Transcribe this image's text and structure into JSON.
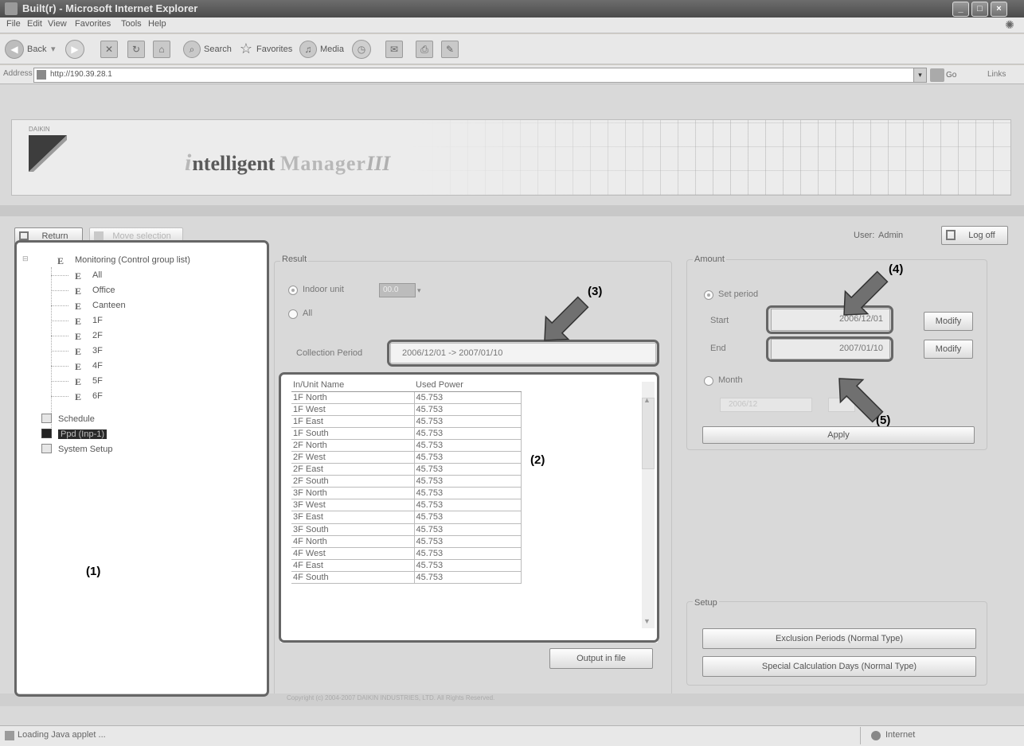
{
  "browser": {
    "title": "Built(r) - Microsoft Internet Explorer",
    "menu": [
      "File",
      "Edit",
      "View",
      "Favorites",
      "Tools",
      "Help"
    ],
    "toolbar": {
      "back": "Back",
      "search": "Search",
      "favorites": "Favorites",
      "media": "Media"
    },
    "address_label": "Address",
    "address": "http://190.39.28.1",
    "go": "Go",
    "links": "Links",
    "status": "Loading Java applet ...",
    "zone": "Internet"
  },
  "app": {
    "brand_label": "DAIKIN",
    "product_title_a": "ntelligent ",
    "product_title_b": "Manager",
    "product_title_c": "III",
    "return_label": "Return",
    "move_selection_label": "Move selection",
    "user_label": "User:",
    "user_value": "Admin",
    "logoff_label": "Log off",
    "copyright": "Copyright (c) 2004-2007 DAIKIN INDUSTRIES, LTD. All Rights Reserved."
  },
  "tree": {
    "root": "Monitoring (Control group list)",
    "groups": [
      "All",
      "Office",
      "Canteen",
      "1F",
      "2F",
      "3F",
      "4F",
      "5F",
      "6F"
    ],
    "schedule": "Schedule",
    "selected": "Ppd (Inp-1)",
    "system_setup": "System Setup"
  },
  "result": {
    "title": "Result",
    "indoor_unit_label": "Indoor unit",
    "indoor_unit_value": "00.0",
    "all_label": "All",
    "collection_period_label": "Collection Period",
    "collection_period_value": "2006/12/01 -> 2007/01/10",
    "columns": [
      "In/Unit Name",
      "Used Power"
    ],
    "rows": [
      [
        "1F North",
        "45.753"
      ],
      [
        "1F West",
        "45.753"
      ],
      [
        "1F East",
        "45.753"
      ],
      [
        "1F South",
        "45.753"
      ],
      [
        "2F North",
        "45.753"
      ],
      [
        "2F West",
        "45.753"
      ],
      [
        "2F East",
        "45.753"
      ],
      [
        "2F South",
        "45.753"
      ],
      [
        "3F North",
        "45.753"
      ],
      [
        "3F West",
        "45.753"
      ],
      [
        "3F East",
        "45.753"
      ],
      [
        "3F South",
        "45.753"
      ],
      [
        "4F North",
        "45.753"
      ],
      [
        "4F West",
        "45.753"
      ],
      [
        "4F East",
        "45.753"
      ],
      [
        "4F South",
        "45.753"
      ]
    ],
    "output_label": "Output in file"
  },
  "amount": {
    "title": "Amount",
    "set_period_label": "Set period",
    "start_label": "Start",
    "start_value": "2006/12/01",
    "end_label": "End",
    "end_value": "2007/01/10",
    "modify_label": "Modify",
    "month_label": "Month",
    "month_value": "2006/12",
    "apply_label": "Apply"
  },
  "setup": {
    "title": "Setup",
    "exclusion_label": "Exclusion Periods (Normal Type)",
    "special_label": "Special Calculation Days (Normal Type)"
  },
  "callouts": {
    "c1": "(1)",
    "c2": "(2)",
    "c3": "(3)",
    "c4": "(4)",
    "c5": "(5)"
  }
}
